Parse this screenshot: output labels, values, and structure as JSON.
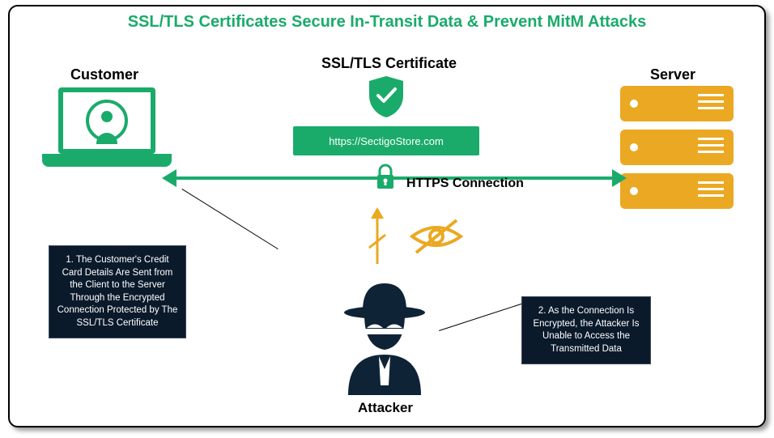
{
  "title": "SSL/TLS Certificates Secure In-Transit Data & Prevent MitM Attacks",
  "labels": {
    "customer": "Customer",
    "certificate": "SSL/TLS Certificate",
    "server": "Server",
    "attacker": "Attacker",
    "connection": "HTTPS Connection"
  },
  "url_bar": "https://SectigoStore.com",
  "callouts": {
    "c1": "1. The Customer's Credit Card Details Are Sent from the Client to the Server Through the Encrypted Connection Protected by The SSL/TLS Certificate",
    "c2": "2. As the Connection Is Encrypted, the Attacker Is Unable to Access the Transmitted Data"
  },
  "colors": {
    "green": "#1aab6b",
    "amber": "#eba822",
    "callout_bg": "#0b1a2b"
  },
  "icons": {
    "laptop": "laptop-with-user",
    "shield": "shield-check",
    "lock": "padlock",
    "server": "server-rack",
    "attacker": "masked-hat-figure",
    "blocked_arrow": "arrow-up-crossed",
    "no_visibility": "eye-crossed-out"
  }
}
